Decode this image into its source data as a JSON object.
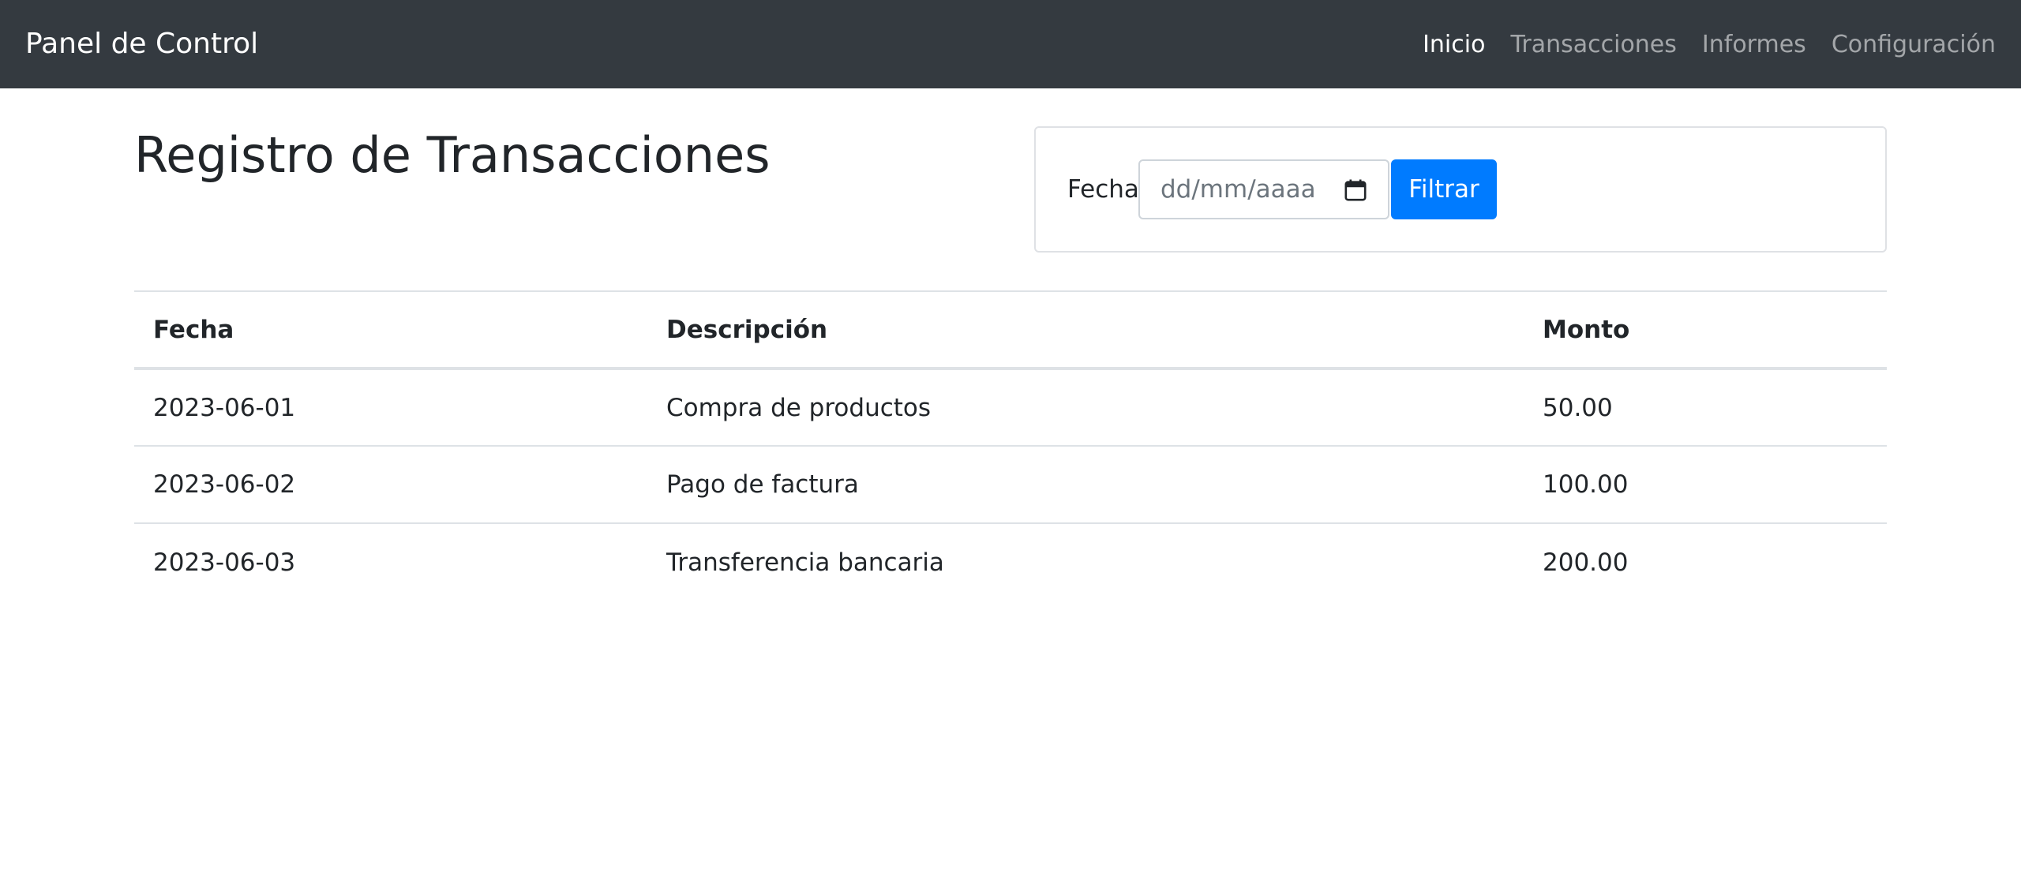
{
  "navbar": {
    "brand": "Panel de Control",
    "links": [
      {
        "label": "Inicio",
        "active": true
      },
      {
        "label": "Transacciones",
        "active": false
      },
      {
        "label": "Informes",
        "active": false
      },
      {
        "label": "Configuración",
        "active": false
      }
    ]
  },
  "page": {
    "title": "Registro de Transacciones"
  },
  "filter": {
    "label": "Fecha:",
    "date_placeholder": "dd/mm/aaaa",
    "button_label": "Filtrar",
    "icon": "calendar-icon"
  },
  "table": {
    "headers": [
      "Fecha",
      "Descripción",
      "Monto"
    ],
    "rows": [
      [
        "2023-06-01",
        "Compra de productos",
        "50.00"
      ],
      [
        "2023-06-02",
        "Pago de factura",
        "100.00"
      ],
      [
        "2023-06-03",
        "Transferencia bancaria",
        "200.00"
      ]
    ]
  },
  "colors": {
    "navbar_bg": "#343a40",
    "primary": "#007bff",
    "text": "#212529"
  }
}
